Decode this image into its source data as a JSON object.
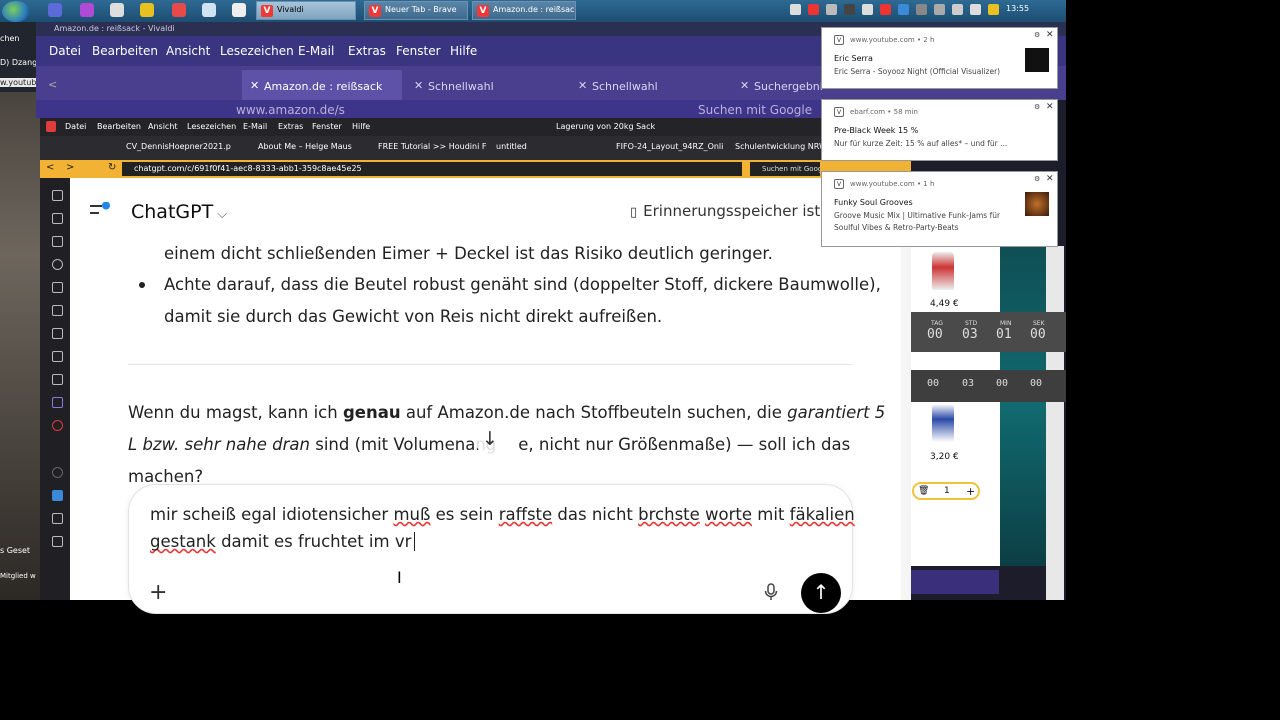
{
  "taskbar": {
    "tasks": [
      "Vivaldi",
      "Neuer Tab - Brave",
      "Amazon.de : reißsac..."
    ],
    "clock": "13:55"
  },
  "left_app": {
    "texts": [
      "chen",
      "D) Dzango",
      "w.youtub",
      "s Geset",
      "Mitglied w"
    ]
  },
  "outer_window": {
    "title": "Amazon.de : reißsack - Vivaldi",
    "menu": [
      "Datei",
      "Bearbeiten",
      "Ansicht",
      "Lesezeichen",
      "E-Mail",
      "Extras",
      "Fenster",
      "Hilfe"
    ],
    "tabs": [
      "Amazon.de : reißsack",
      "Schnellwahl",
      "Schnellwahl",
      "Suchergebni"
    ],
    "address": "www.amazon.de/s",
    "search_placeholder": "Suchen mit Google"
  },
  "inner_window": {
    "menu": [
      "Datei",
      "Bearbeiten",
      "Ansicht",
      "Lesezeichen",
      "E-Mail",
      "Extras",
      "Fenster",
      "Hilfe"
    ],
    "window_label": "Lagerung von 20kg Sack",
    "bookmarks": [
      "CV_DennisHoepner2021.p",
      "About Me – Helge Maus",
      "FREE Tutorial >> Houdini F",
      "untitled",
      "FIFO-24_Layout_94RZ_Onli",
      "Schulentwicklung NRW"
    ],
    "url": "chatgpt.com/c/691f0f41-aec8-8333-abb1-359c8ae45e25",
    "search": "Suchen mit Google"
  },
  "chatgpt": {
    "title": "ChatGPT",
    "memory_button": "Erinnerungsspeicher ist",
    "line1": "einem dicht schließenden Eimer + Deckel ist das Risiko deutlich geringer.",
    "bullet_line1": "Achte darauf, dass die Beutel robust genäht sind (doppelter Stoff, dickere Baumwolle),",
    "bullet_line2": "damit sie durch das Gewicht von Reis nicht direkt aufreißen.",
    "resp": {
      "a": "Wenn du magst, kann ich ",
      "b": "genau",
      "c": " auf Amazon.de nach Stoffbeuteln suchen, die ",
      "d": "garantiert 5",
      "e": "L bzw. sehr nahe dran",
      "f": " sind (mit Volumenang",
      "g": "e, nicht nur Größenmaße) — soll ich das",
      "h": "machen?"
    },
    "composer": {
      "l1a": "mir scheiß egal idiotensicher ",
      "l1b": "muß",
      "l1c": " es sein ",
      "l1d": "raffste",
      "l1e": " das nicht ",
      "l1f": "brchste",
      "l1g": " ",
      "l1h": "worte",
      "l1i": " mit ",
      "l1j": "fäkalien",
      "l2a": "gestank",
      "l2b": " damit es fruchtet im vr"
    }
  },
  "amazon_bg": {
    "price1": "4,49 €",
    "price2": "3,20 €",
    "timer_labels": [
      "TAG",
      "STD",
      "MIN",
      "SEK"
    ],
    "timer_values": [
      "00",
      "03",
      "01",
      "00"
    ],
    "timer2_values": [
      "00",
      "03",
      "00",
      "00"
    ],
    "qty": "1"
  },
  "notifications": [
    {
      "source": "www.youtube.com  •  2 h",
      "title": "Eric Serra",
      "body": "Eric Serra - Soyooz Night (Official Visualizer)",
      "body2": ""
    },
    {
      "source": "ebarf.com  •  58 min",
      "title": "Pre-Black Week 15 %",
      "body": "Nur für kurze Zeit: 15 % auf alles* – und für ...",
      "body2": ""
    },
    {
      "source": "www.youtube.com  •  1 h",
      "title": "Funky Soul Grooves",
      "body": "Groove Music Mix | Ultimative Funk-Jams für",
      "body2": "Soulful Vibes & Retro-Party-Beats"
    }
  ]
}
